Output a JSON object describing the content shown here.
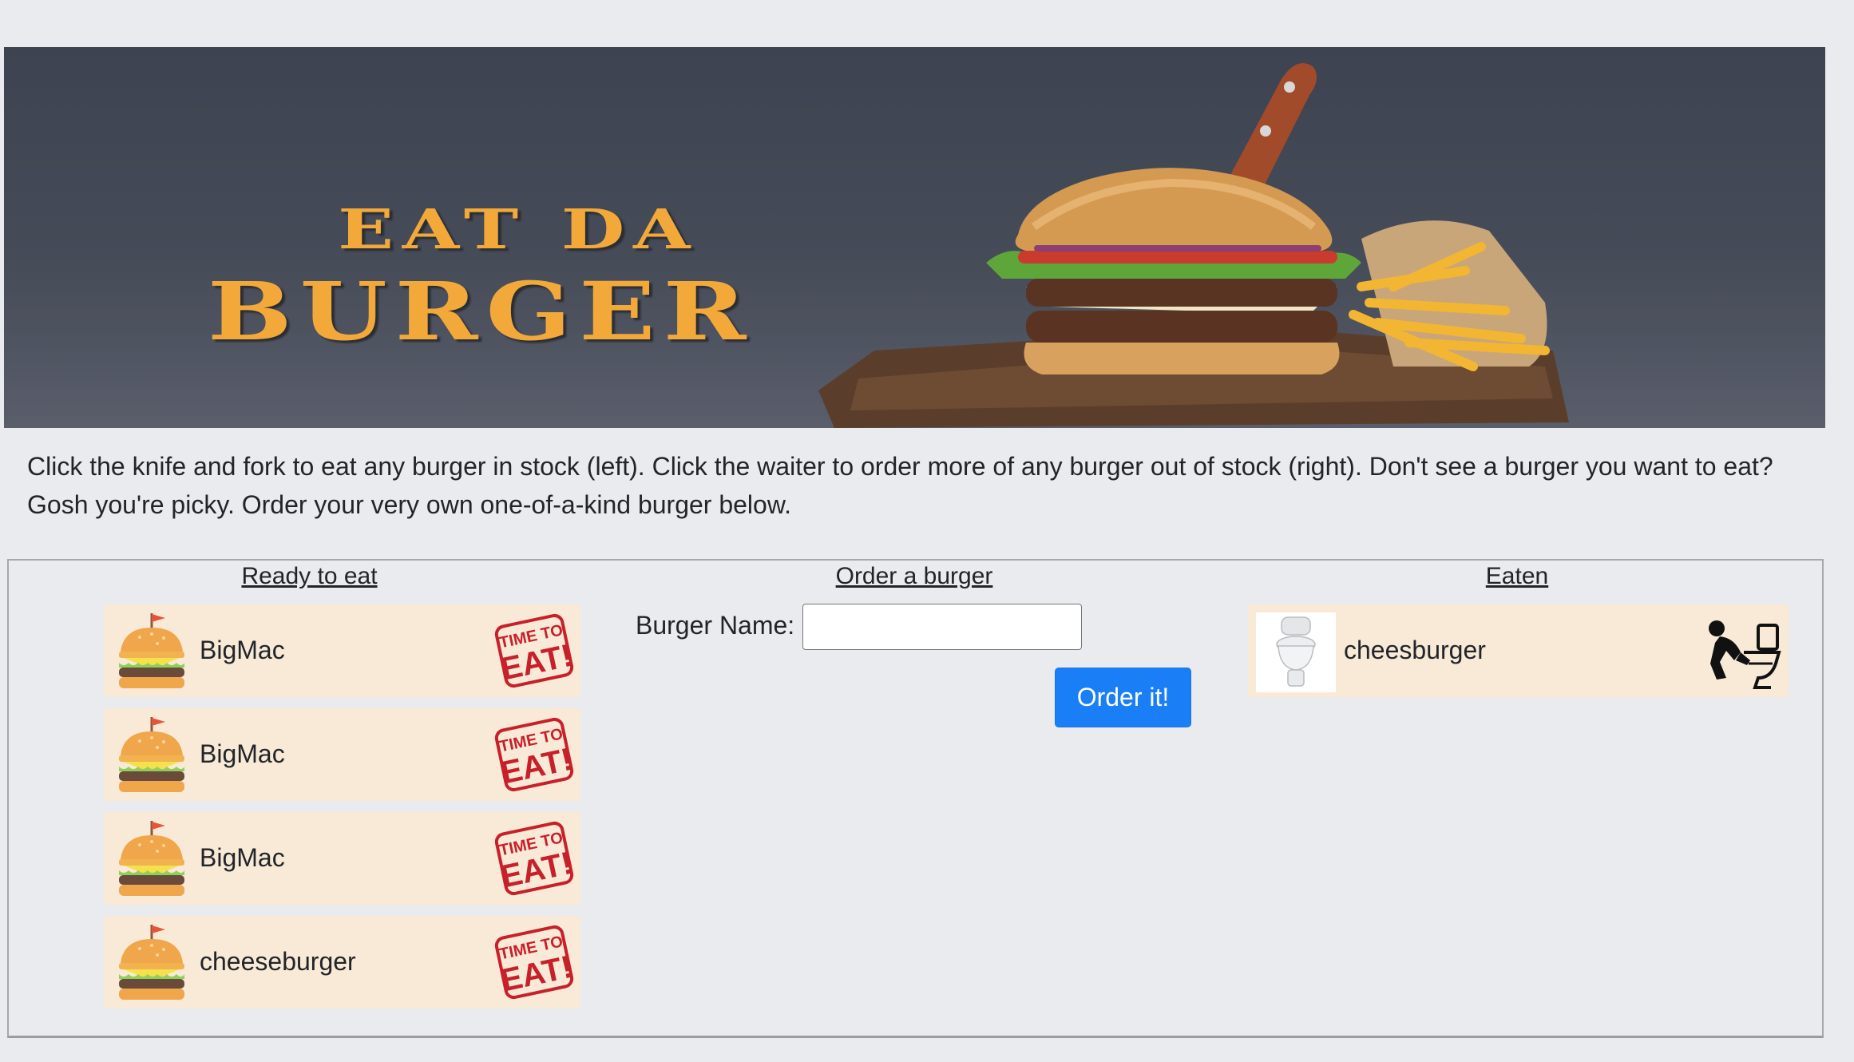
{
  "banner": {
    "line1": "EAT DA",
    "line2": "BURGER"
  },
  "instructions": "Click the knife and fork to eat any burger in stock (left). Click the waiter to order more of any burger out of stock (right). Don't see a burger you want to eat? Gosh you're picky. Order your very own one-of-a-kind burger below.",
  "columns": {
    "ready": {
      "heading": "Ready to eat"
    },
    "order": {
      "heading": "Order a burger"
    },
    "eaten": {
      "heading": "Eaten"
    }
  },
  "ready_items": [
    {
      "name": "BigMac",
      "icon": "burger-icon",
      "action_icon": "time-to-eat-stamp-icon",
      "stamp_text_top": "TIME TO",
      "stamp_text_bottom": "EAT!"
    },
    {
      "name": "BigMac",
      "icon": "burger-icon",
      "action_icon": "time-to-eat-stamp-icon",
      "stamp_text_top": "TIME TO",
      "stamp_text_bottom": "EAT!"
    },
    {
      "name": "BigMac",
      "icon": "burger-icon",
      "action_icon": "time-to-eat-stamp-icon",
      "stamp_text_top": "TIME TO",
      "stamp_text_bottom": "EAT!"
    },
    {
      "name": "cheeseburger",
      "icon": "burger-icon",
      "action_icon": "time-to-eat-stamp-icon",
      "stamp_text_top": "TIME TO",
      "stamp_text_bottom": "EAT!"
    }
  ],
  "order_form": {
    "label": "Burger Name:",
    "input_value": "",
    "input_placeholder": "",
    "button_label": "Order it!"
  },
  "eaten_items": [
    {
      "name": "cheesburger",
      "icon": "toilet-icon",
      "action_icon": "person-on-toilet-icon"
    }
  ],
  "colors": {
    "page_bg": "#e9ebee",
    "card_bg": "#f9ead8",
    "button_bg": "#1a7ff6",
    "banner_text": "#f3a93a",
    "stamp_red": "#c8202a"
  }
}
